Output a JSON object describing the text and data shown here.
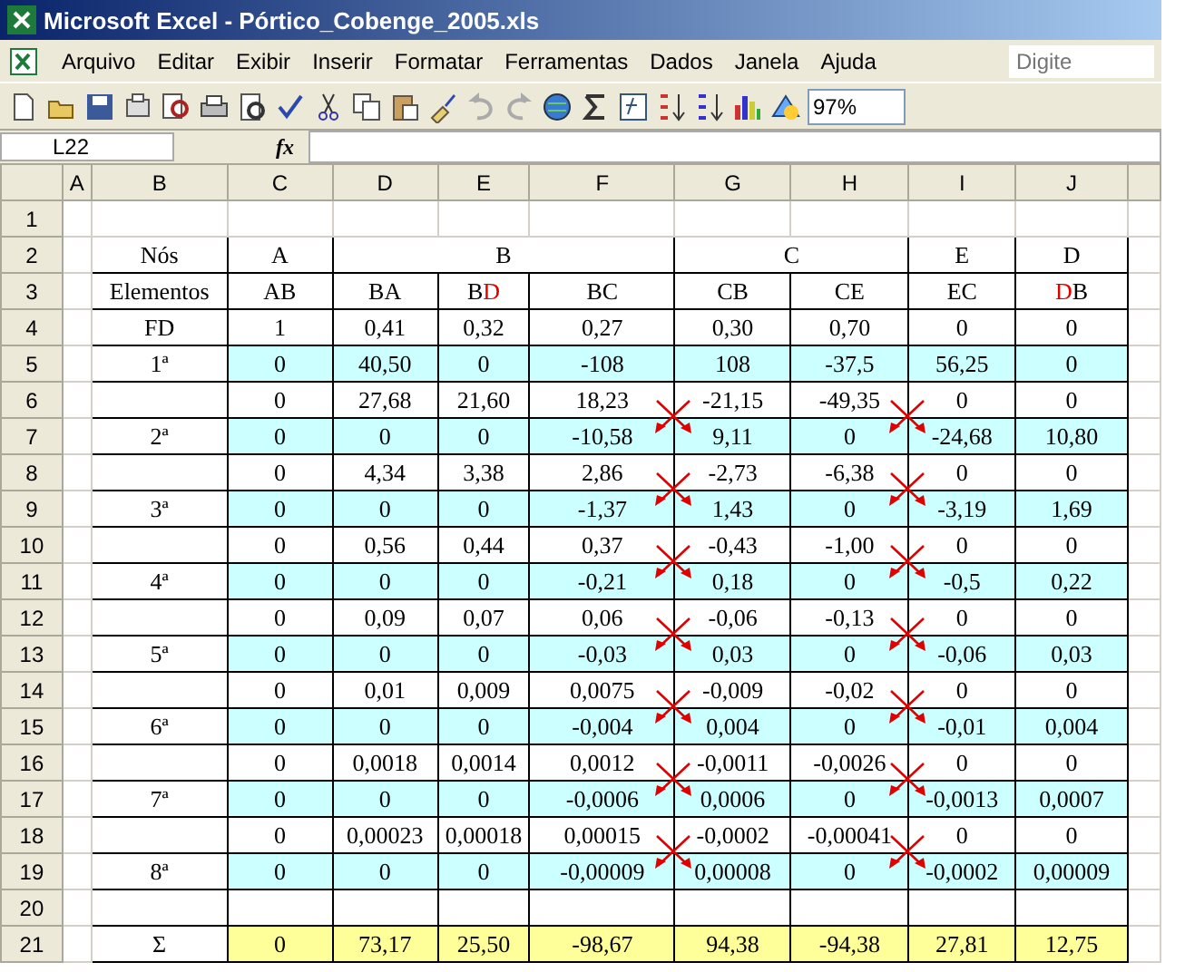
{
  "window": {
    "title": "Microsoft Excel - Pórtico_Cobenge_2005.xls"
  },
  "menu": [
    "Arquivo",
    "Editar",
    "Exibir",
    "Inserir",
    "Formatar",
    "Ferramentas",
    "Dados",
    "Janela",
    "Ajuda"
  ],
  "help_box": {
    "placeholder": "Digite"
  },
  "toolbar": {
    "zoom": "97%"
  },
  "formula_bar": {
    "name_box": "L22",
    "function_label": "fx"
  },
  "column_headers": [
    "A",
    "B",
    "C",
    "D",
    "E",
    "F",
    "G",
    "H",
    "I",
    "J"
  ],
  "nodes": [
    {
      "name": "A",
      "elements": [
        {
          "parts": [
            {
              "text": "AB",
              "accent": false
            }
          ]
        }
      ]
    },
    {
      "name": "B",
      "elements": [
        {
          "parts": [
            {
              "text": "BA",
              "accent": false
            }
          ]
        },
        {
          "parts": [
            {
              "text": "B",
              "accent": false
            },
            {
              "text": "D",
              "accent": true
            }
          ]
        },
        {
          "parts": [
            {
              "text": "BC",
              "accent": false
            }
          ]
        }
      ]
    },
    {
      "name": "C",
      "elements": [
        {
          "parts": [
            {
              "text": "CB",
              "accent": false
            }
          ]
        },
        {
          "parts": [
            {
              "text": "CE",
              "accent": false
            }
          ]
        }
      ]
    },
    {
      "name": "E",
      "elements": [
        {
          "parts": [
            {
              "text": "EC",
              "accent": false
            }
          ]
        }
      ]
    },
    {
      "name": "D",
      "elements": [
        {
          "parts": [
            {
              "text": "D",
              "accent": true
            },
            {
              "text": "B",
              "accent": false
            }
          ]
        }
      ]
    }
  ],
  "rows": [
    {
      "number": "1",
      "kind": "blank"
    },
    {
      "number": "2",
      "kind": "nodes",
      "label": "Nós"
    },
    {
      "number": "3",
      "kind": "elements",
      "label": "Elementos"
    },
    {
      "number": "4",
      "kind": "plain",
      "arrows": false,
      "label": "FD",
      "values": [
        "1",
        "0,41",
        "0,32",
        "0,27",
        "0,30",
        "0,70",
        "0",
        "0"
      ]
    },
    {
      "number": "5",
      "kind": "cycle",
      "arrows": false,
      "label": "1ª",
      "values": [
        "0",
        "40,50",
        "0",
        "-108",
        "108",
        "-37,5",
        "56,25",
        "0"
      ]
    },
    {
      "number": "6",
      "kind": "plain",
      "arrows": false,
      "values": [
        "0",
        "27,68",
        "21,60",
        "18,23",
        "-21,15",
        "-49,35",
        "0",
        "0"
      ]
    },
    {
      "number": "7",
      "kind": "cycle",
      "arrows": true,
      "label": "2ª",
      "values": [
        "0",
        "0",
        "0",
        "-10,58",
        "9,11",
        "0",
        "-24,68",
        "10,80"
      ]
    },
    {
      "number": "8",
      "kind": "plain",
      "arrows": false,
      "values": [
        "0",
        "4,34",
        "3,38",
        "2,86",
        "-2,73",
        "-6,38",
        "0",
        "0"
      ]
    },
    {
      "number": "9",
      "kind": "cycle",
      "arrows": true,
      "label": "3ª",
      "values": [
        "0",
        "0",
        "0",
        "-1,37",
        "1,43",
        "0",
        "-3,19",
        "1,69"
      ]
    },
    {
      "number": "10",
      "kind": "plain",
      "arrows": false,
      "values": [
        "0",
        "0,56",
        "0,44",
        "0,37",
        "-0,43",
        "-1,00",
        "0",
        "0"
      ]
    },
    {
      "number": "11",
      "kind": "cycle",
      "arrows": true,
      "label": "4ª",
      "values": [
        "0",
        "0",
        "0",
        "-0,21",
        "0,18",
        "0",
        "-0,5",
        "0,22"
      ]
    },
    {
      "number": "12",
      "kind": "plain",
      "arrows": false,
      "values": [
        "0",
        "0,09",
        "0,07",
        "0,06",
        "-0,06",
        "-0,13",
        "0",
        "0"
      ]
    },
    {
      "number": "13",
      "kind": "cycle",
      "arrows": true,
      "label": "5ª",
      "values": [
        "0",
        "0",
        "0",
        "-0,03",
        "0,03",
        "0",
        "-0,06",
        "0,03"
      ]
    },
    {
      "number": "14",
      "kind": "plain",
      "arrows": false,
      "values": [
        "0",
        "0,01",
        "0,009",
        "0,0075",
        "-0,009",
        "-0,02",
        "0",
        "0"
      ]
    },
    {
      "number": "15",
      "kind": "cycle",
      "arrows": true,
      "label": "6ª",
      "values": [
        "0",
        "0",
        "0",
        "-0,004",
        "0,004",
        "0",
        "-0,01",
        "0,004"
      ]
    },
    {
      "number": "16",
      "kind": "plain",
      "arrows": false,
      "values": [
        "0",
        "0,0018",
        "0,0014",
        "0,0012",
        "-0,0011",
        "-0,0026",
        "0",
        "0"
      ]
    },
    {
      "number": "17",
      "kind": "cycle",
      "arrows": true,
      "label": "7ª",
      "values": [
        "0",
        "0",
        "0",
        "-0,0006",
        "0,0006",
        "0",
        "-0,0013",
        "0,0007"
      ]
    },
    {
      "number": "18",
      "kind": "plain",
      "arrows": false,
      "values": [
        "0",
        "0,00023",
        "0,00018",
        "0,00015",
        "-0,0002",
        "-0,00041",
        "0",
        "0"
      ]
    },
    {
      "number": "19",
      "kind": "cycle",
      "arrows": true,
      "label": "8ª",
      "values": [
        "0",
        "0",
        "0",
        "-0,00009",
        "0,00008",
        "0",
        "-0,0002",
        "0,00009"
      ]
    },
    {
      "number": "20",
      "kind": "spacer"
    },
    {
      "number": "21",
      "kind": "sum",
      "arrows": false,
      "label": "Σ",
      "values": [
        "0",
        "73,17",
        "25,50",
        "-98,67",
        "94,38",
        "-94,38",
        "27,81",
        "12,75"
      ]
    }
  ]
}
